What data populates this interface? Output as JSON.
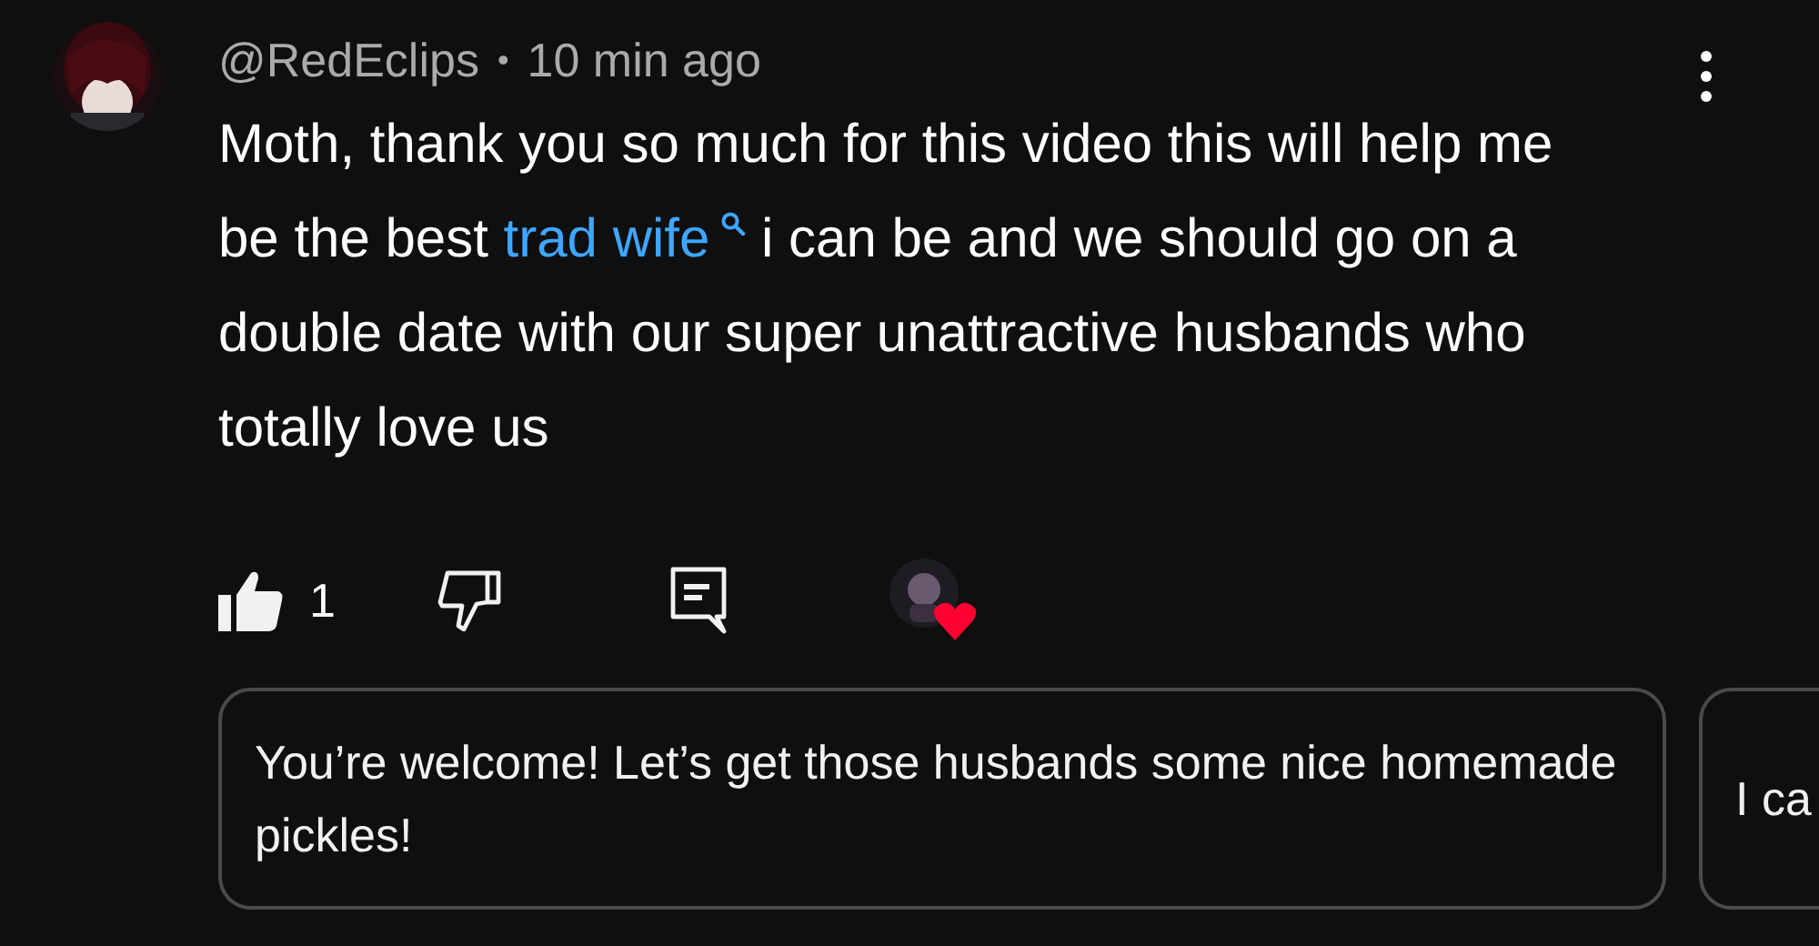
{
  "comment": {
    "author": "@RedEclips",
    "separator": "•",
    "time": "10 min ago",
    "body_before": "Moth, thank you so much for this video this will help me be the best ",
    "link": "trad wife",
    "body_after": " i can be and we should go on a double date with our super unattractive husbands who totally love us",
    "like_count": "1",
    "liked": true,
    "creator_hearted": true
  },
  "suggested_replies": [
    {
      "text": "You’re welcome! Let’s get those husbands some nice homemade pickles!"
    },
    {
      "text": "I ca"
    }
  ]
}
